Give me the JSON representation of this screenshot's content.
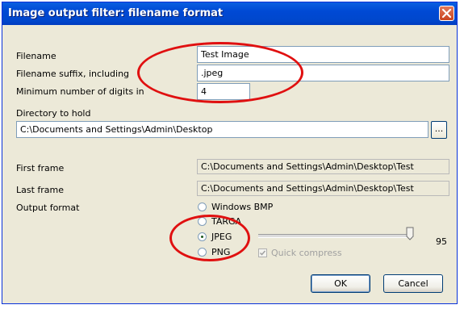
{
  "window": {
    "title": "Image output filter: filename format"
  },
  "fields": {
    "filename_label": "Filename",
    "filename_value": "Test Image",
    "suffix_label": "Filename suffix, including",
    "suffix_value": ".jpeg",
    "digits_label": "Minimum number of digits in",
    "digits_value": "4",
    "directory_label": "Directory to hold",
    "directory_value": "C:\\Documents and Settings\\Admin\\Desktop",
    "browse_label": "..."
  },
  "frames": {
    "first_label": "First frame",
    "first_value": "C:\\Documents and Settings\\Admin\\Desktop\\Test",
    "last_label": "Last frame",
    "last_value": "C:\\Documents and Settings\\Admin\\Desktop\\Test"
  },
  "output": {
    "label": "Output format",
    "options": [
      "Windows BMP",
      "TARGA",
      "JPEG",
      "PNG"
    ],
    "selected": "JPEG",
    "quality_value": "95",
    "quality_level": 0.95,
    "quick_compress_label": "Quick compress"
  },
  "buttons": {
    "ok": "OK",
    "cancel": "Cancel"
  },
  "colors": {
    "title_bar": "#0054e3",
    "annotation": "#e01010",
    "dialog_bg": "#ece9d8"
  }
}
